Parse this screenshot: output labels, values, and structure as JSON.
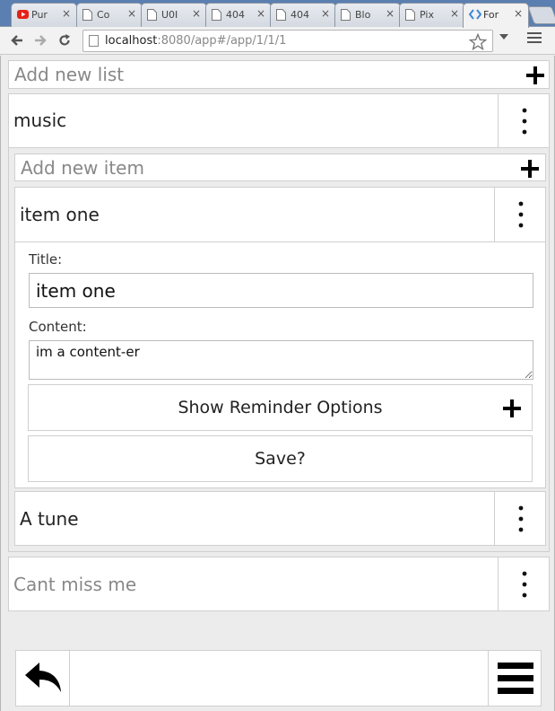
{
  "browser": {
    "tabs": [
      {
        "title": "Pur",
        "icon": "youtube-icon",
        "active": false
      },
      {
        "title": "Co",
        "icon": "page-icon",
        "active": false
      },
      {
        "title": "U0I",
        "icon": "page-icon",
        "active": false
      },
      {
        "title": "404",
        "icon": "page-icon",
        "active": false
      },
      {
        "title": "404",
        "icon": "page-icon",
        "active": false
      },
      {
        "title": "Blo",
        "icon": "page-icon",
        "active": false
      },
      {
        "title": "Pix",
        "icon": "page-icon",
        "active": false
      },
      {
        "title": "For",
        "icon": "code-icon",
        "active": true
      }
    ],
    "close_glyph": "×",
    "url_host": "localhost",
    "url_rest": ":8080/app#/app/1/1/1"
  },
  "app": {
    "add_list_placeholder": "Add new list",
    "lists": [
      {
        "title": "music"
      },
      {
        "title": "Cant miss me"
      }
    ],
    "add_item_placeholder": "Add new item",
    "items": [
      {
        "title": "item one"
      },
      {
        "title": "A tune"
      }
    ],
    "editor": {
      "title_label": "Title:",
      "title_value": "item one",
      "content_label": "Content:",
      "content_value": "im a content-er",
      "reminder_label": "Show Reminder Options",
      "save_label": "Save?"
    }
  },
  "colors": {
    "tabstrip": "#5a7fb0",
    "youtube": "#e62117",
    "code_icon": "#3b8ad8"
  }
}
